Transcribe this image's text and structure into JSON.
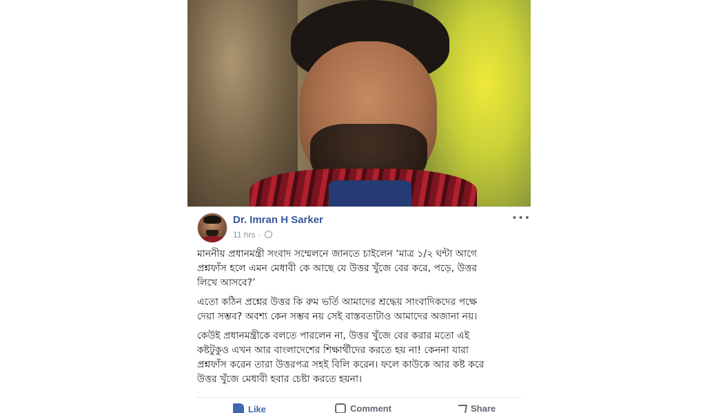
{
  "post": {
    "author": "Dr. Imran H Sarker",
    "time": "11 hrs",
    "more_label": "•••",
    "paragraphs": [
      "মাননীয় প্রধানমন্ত্রী সংবাদ সম্মেলনে জানতে চাইলেন ‘মাত্র ১/২ ঘন্টা আগে\nপ্রশ্নফাঁস হলে এমন মেধাবী কে আছে যে উত্তর খুঁজে বের করে, পড়ে, উত্তর\nলিখে আসবে?’",
      "এতো কঠিন প্রশ্নের উত্তর কি রুম ভর্তি আমাদের শ্রদ্ধেয় সাংবাদিকদের পক্ষে\nদেয়া সম্ভব? অবশ্য কেন সম্ভব নয় সেই বাস্তবতাটাও আমাদের অজানা নয়।",
      "কেউই প্রধানমন্ত্রীকে বলতে পারলেন না, উত্তর খুঁজে বের করার মতো এই\nকষ্টটুকুও এখন আর বাংলাদেশের শিক্ষার্থীদের করতে হয় না! কেননা যারা\nপ্রশ্নফাঁস করেন তারা উত্তরপত্র সহই বিলি করেন। ফলে কাউকে আর কষ্ট করে\nউত্তর খুঁজে মেধাবী হবার চেষ্টা করতে হয়না।"
    ]
  },
  "actions": {
    "like": "Like",
    "comment": "Comment",
    "share": "Share"
  },
  "icons": {
    "like": "thumbs-up-icon",
    "comment": "comment-icon",
    "share": "share-icon",
    "privacy": "globe-icon"
  },
  "colors": {
    "author": "#365899",
    "meta": "#90949c",
    "like": "#4267b2"
  }
}
